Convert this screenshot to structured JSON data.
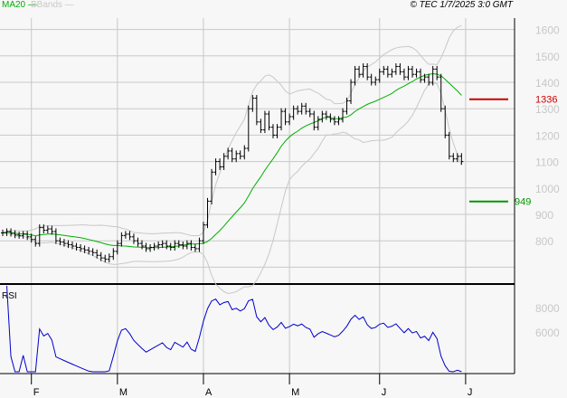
{
  "header": {
    "legend": [
      {
        "label": "MA20",
        "color": "#00b000"
      },
      {
        "label": "BBands",
        "color": "#c8c8c8"
      }
    ],
    "copyright": "© TEC 1/7/2025 3:0 GMT"
  },
  "chart_data": [
    {
      "type": "candlestick",
      "title": "Price with MA20 and Bollinger Bands",
      "y_ticks": [
        "1600",
        "1500",
        "1400",
        "1300",
        "1200",
        "1100",
        "1000",
        "900",
        "800"
      ],
      "ylim": [
        650,
        1660
      ],
      "x_ticks": [
        "F",
        "M",
        "A",
        "M",
        "J",
        "J"
      ],
      "x_tick_index": [
        7,
        28,
        49,
        70,
        92,
        113
      ],
      "closes": [
        830,
        835,
        828,
        822,
        820,
        825,
        815,
        805,
        790,
        850,
        840,
        845,
        835,
        800,
        795,
        790,
        785,
        780,
        775,
        770,
        765,
        760,
        755,
        745,
        735,
        730,
        740,
        760,
        790,
        820,
        825,
        815,
        800,
        790,
        780,
        770,
        775,
        780,
        785,
        790,
        780,
        775,
        790,
        785,
        780,
        790,
        775,
        770,
        800,
        860,
        950,
        1060,
        1100,
        1080,
        1120,
        1140,
        1110,
        1130,
        1120,
        1150,
        1300,
        1340,
        1250,
        1220,
        1280,
        1230,
        1200,
        1230,
        1290,
        1250,
        1270,
        1300,
        1290,
        1310,
        1290,
        1280,
        1230,
        1260,
        1280,
        1270,
        1260,
        1250,
        1260,
        1290,
        1330,
        1400,
        1450,
        1430,
        1460,
        1420,
        1400,
        1410,
        1440,
        1450,
        1430,
        1440,
        1460,
        1440,
        1420,
        1450,
        1430,
        1440,
        1410,
        1420,
        1400,
        1450,
        1420,
        1300,
        1200,
        1120,
        1110,
        1120,
        1100
      ],
      "levels": [
        {
          "label": "1336",
          "value": 1336,
          "color": "#cc0000"
        },
        {
          "label": "949",
          "value": 949,
          "color": "#009900"
        }
      ],
      "ma_period": 20
    },
    {
      "type": "line",
      "title": "RSI",
      "y_ticks": [
        "8000",
        "6000"
      ],
      "rsi_period": 14,
      "color": "#0000cc"
    }
  ]
}
